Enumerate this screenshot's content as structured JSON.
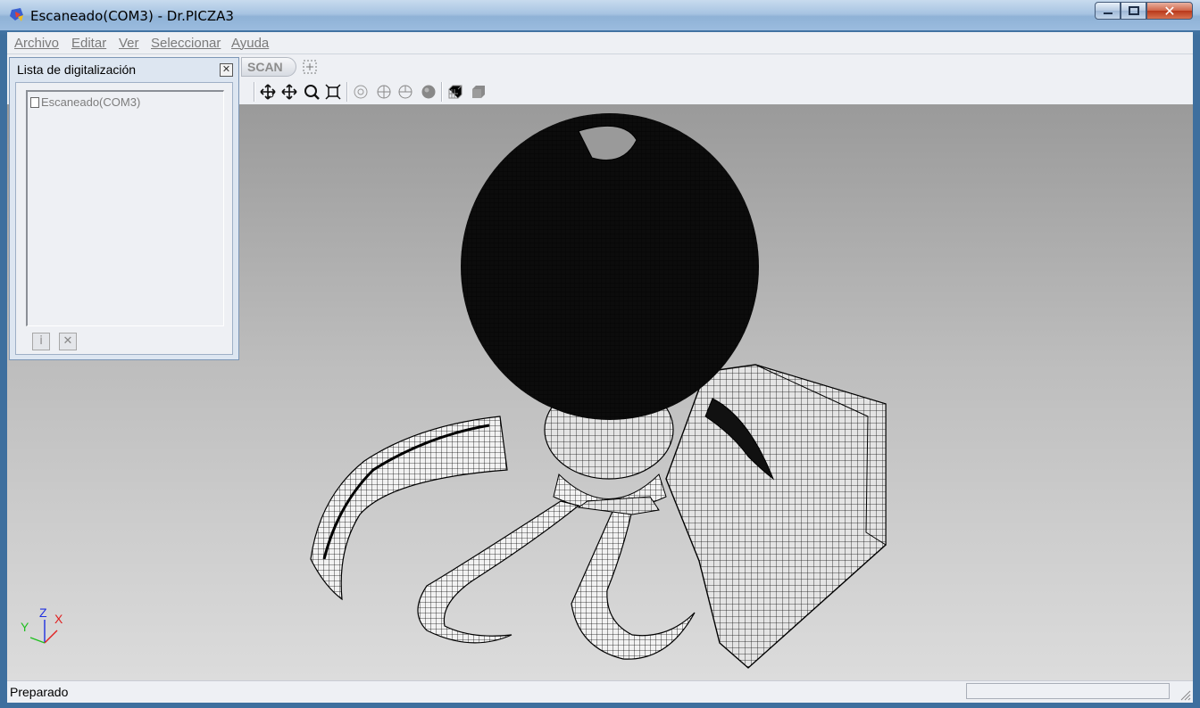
{
  "window": {
    "title": "Escaneado(COM3) - Dr.PICZA3",
    "minimize_icon": "minimize-icon",
    "maximize_icon": "maximize-icon",
    "close_icon": "close-icon"
  },
  "menu": {
    "items": [
      {
        "label": "Archivo"
      },
      {
        "label": "Editar"
      },
      {
        "label": "Ver"
      },
      {
        "label": "Seleccionar"
      },
      {
        "label": "Ayuda"
      }
    ]
  },
  "toolbar": {
    "scan_label": "SCAN",
    "icons": [
      "select-area-icon",
      "pan-rotate-icon",
      "move-icon",
      "zoom-icon",
      "fit-view-icon",
      "view-front-icon",
      "view-side-icon",
      "view-top-icon",
      "shaded-sphere-icon",
      "mesh-icon",
      "solid-icon"
    ]
  },
  "panel": {
    "title": "Lista de digitalización",
    "items": [
      {
        "label": "Escaneado(COM3)",
        "icon": "document-icon"
      }
    ],
    "buttons": [
      {
        "icon": "info-icon"
      },
      {
        "icon": "delete-icon"
      }
    ]
  },
  "axis": {
    "x": "X",
    "y": "Y",
    "z": "Z"
  },
  "colors": {
    "axis_x": "#e02020",
    "axis_y": "#20c020",
    "axis_z": "#2030e0"
  },
  "status": {
    "text": "Preparado"
  }
}
